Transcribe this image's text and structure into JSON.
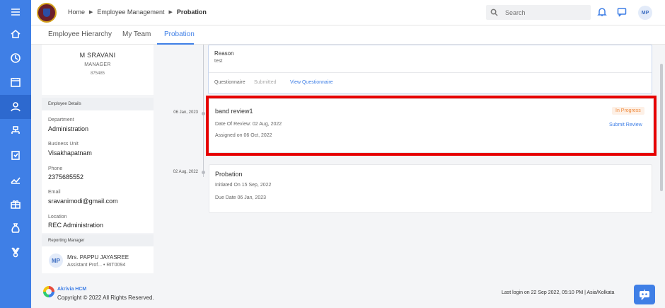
{
  "header": {
    "breadcrumb": [
      "Home",
      "Employee Management",
      "Probation"
    ],
    "search_placeholder": "Search",
    "user_initials": "MP"
  },
  "tabs": [
    "Employee Hierarchy",
    "My Team",
    "Probation"
  ],
  "active_tab": "Probation",
  "profile": {
    "name": "M SRAVANI",
    "role": "MANAGER",
    "employee_id": "875485"
  },
  "employee_details": {
    "section_title": "Employee Details",
    "fields": [
      {
        "label": "Department",
        "value": "Administration"
      },
      {
        "label": "Business Unit",
        "value": "Visakhapatnam"
      },
      {
        "label": "Phone",
        "value": "2375685552"
      },
      {
        "label": "Email",
        "value": "sravanimodi@gmail.com"
      },
      {
        "label": "Location",
        "value": "REC Administration"
      }
    ]
  },
  "reporting_manager": {
    "section_title": "Reporting Manager",
    "initials": "MP",
    "name": "Mrs. PAPPU JAYASREE",
    "designation": "Assistant Prof...",
    "employee_code": "• RIT0094"
  },
  "timeline": {
    "reason_card": {
      "reason_label": "Reason",
      "reason_value": "test",
      "questionnaire_label": "Questionnaire",
      "questionnaire_status": "Submitted",
      "view_link": "View Questionnaire"
    },
    "review_card": {
      "date": "06 Jan, 2023",
      "title": "band review1",
      "status": "In Progress",
      "date_of_review": "Date Of Review: 02 Aug, 2022",
      "assigned_on": "Assigned on 06 Oct, 2022",
      "action": "Submit Review"
    },
    "probation_card": {
      "date": "02 Aug, 2022",
      "title": "Probation",
      "initiated_on": "Initiated On 15 Sep, 2022",
      "due_date": "Due Date 06 Jan, 2023"
    }
  },
  "footer": {
    "brand": "Akrivia HCM",
    "copyright": "Copyright © 2022 All Rights Reserved.",
    "last_login": "Last login on 22 Sep 2022, 05:10 PM  | Asia/Kolkata"
  },
  "colors": {
    "primary": "#3f7fe6",
    "highlight": "#e60000",
    "status_in_progress": "#f08a3c"
  },
  "sidebar_icons": [
    "menu-icon",
    "home-icon",
    "clock-icon",
    "calendar-icon",
    "user-icon",
    "hierarchy-icon",
    "clipboard-icon",
    "chart-icon",
    "gift-icon",
    "moneybag-icon",
    "award-icon"
  ]
}
